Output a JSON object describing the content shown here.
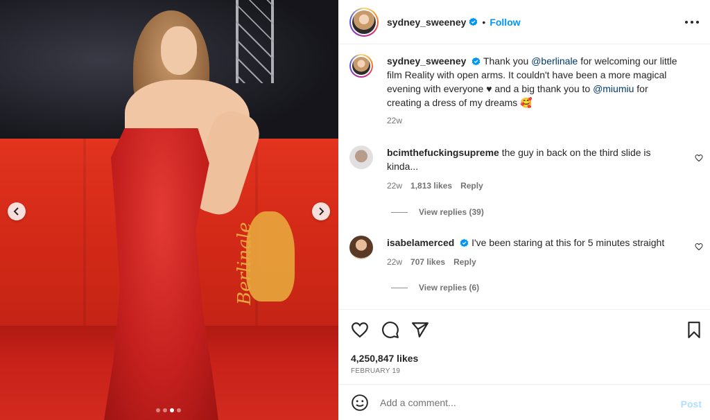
{
  "post": {
    "username": "sydney_sweeney",
    "follow_label": "Follow",
    "separator": "•",
    "caption_prefix": "Thank you ",
    "caption_mention1": "@berlinale",
    "caption_mid": " for welcoming our little film Reality with open arms. It couldn't have been a more magical evening with everyone ♥ and a big thank you to ",
    "caption_mention2": "@miumiu",
    "caption_suffix": " for creating a dress of my dreams 🥰",
    "caption_time": "22w",
    "likes": "4,250,847 likes",
    "date": "FEBRUARY 19"
  },
  "carousel": {
    "slides": 4,
    "active": 3
  },
  "comments": [
    {
      "username": "bcimthefuckingsupreme",
      "text": "the guy in back on the third slide is kinda...",
      "time": "22w",
      "likes": "1,813 likes",
      "reply_label": "Reply",
      "view_replies": "View replies (39)"
    },
    {
      "username": "isabelamerced",
      "text": "I've been staring at this for 5 minutes straight",
      "time": "22w",
      "likes": "707 likes",
      "reply_label": "Reply",
      "view_replies": "View replies (6)"
    }
  ],
  "composer": {
    "placeholder": "Add a comment...",
    "post_label": "Post"
  },
  "photo_text": {
    "watermark": "Berlinale"
  },
  "colors": {
    "link": "#0095f6",
    "mention": "#00376b",
    "muted": "#737373",
    "text": "#262626"
  },
  "icons": [
    "chevron-left-icon",
    "chevron-right-icon",
    "verified-icon",
    "more-icon",
    "heart-icon",
    "comment-icon",
    "share-icon",
    "bookmark-icon",
    "emoji-icon"
  ]
}
